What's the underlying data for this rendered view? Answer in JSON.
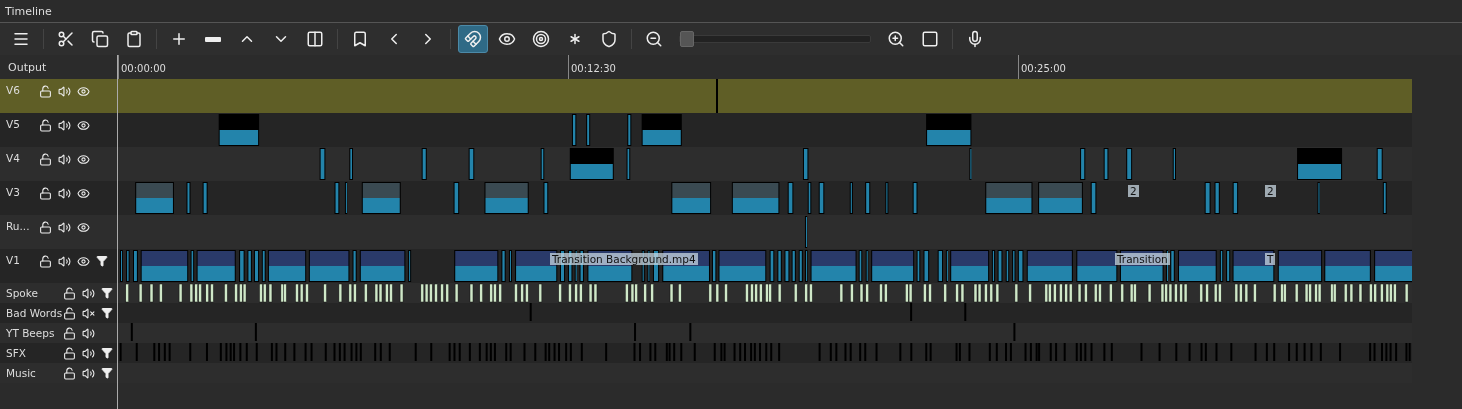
{
  "panel": {
    "title": "Timeline"
  },
  "toolbar": {
    "toggles": [
      {
        "kind": "snap",
        "selected": true
      },
      {
        "kind": "scrub",
        "selected": false
      },
      {
        "kind": "ripple",
        "selected": false
      },
      {
        "kind": "ripple-all",
        "selected": false
      },
      {
        "kind": "ripple-markers",
        "selected": false
      }
    ],
    "zoom": {
      "level": 0.0
    }
  },
  "output_label": "Output",
  "ruler": {
    "ticks": [
      "00:00:00",
      "00:12:30",
      "00:25:00"
    ]
  },
  "tracks": [
    {
      "name": "V6",
      "kind": "video",
      "selected": true,
      "locked": false,
      "muted": false,
      "filter": false
    },
    {
      "name": "V5",
      "kind": "video",
      "selected": false,
      "locked": false,
      "muted": false,
      "filter": false
    },
    {
      "name": "V4",
      "kind": "video",
      "selected": false,
      "locked": false,
      "muted": false,
      "filter": false
    },
    {
      "name": "V3",
      "kind": "video",
      "selected": false,
      "locked": false,
      "muted": false,
      "filter": false,
      "labels": [
        "2",
        "2"
      ]
    },
    {
      "name": "Ru...",
      "kind": "video",
      "selected": false,
      "locked": false,
      "muted": false,
      "filter": false
    },
    {
      "name": "V1",
      "kind": "video",
      "selected": false,
      "locked": false,
      "muted": false,
      "filter": true,
      "labels": [
        "Transition Background.mp4",
        "Transition",
        "T"
      ]
    },
    {
      "name": "Spoke",
      "kind": "audio",
      "selected": false,
      "locked": false,
      "muted": false,
      "filter": true
    },
    {
      "name": "Bad Words",
      "kind": "audio",
      "selected": false,
      "locked": false,
      "muted": true,
      "filter": true
    },
    {
      "name": "YT Beeps",
      "kind": "audio",
      "selected": false,
      "locked": false,
      "muted": false,
      "filter": false
    },
    {
      "name": "SFX",
      "kind": "audio",
      "selected": false,
      "locked": false,
      "muted": false,
      "filter": true
    },
    {
      "name": "Music",
      "kind": "audio",
      "selected": false,
      "locked": false,
      "muted": false,
      "filter": true
    }
  ]
}
